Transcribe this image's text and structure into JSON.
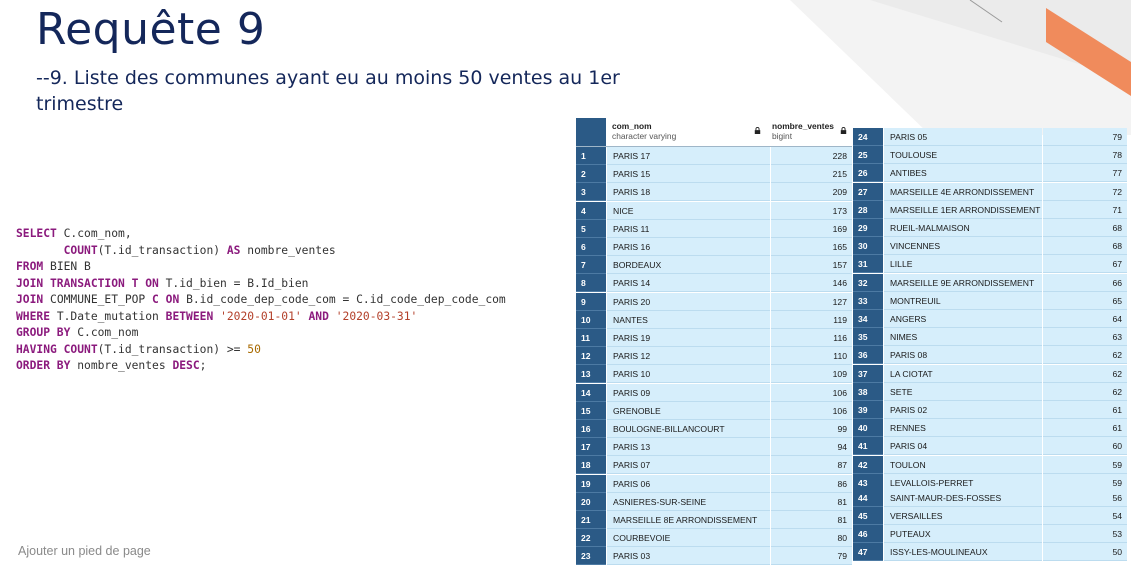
{
  "slide": {
    "title": "Requête 9",
    "subtitle": "--9. Liste des communes ayant eu au moins 50 ventes au 1er trimestre",
    "footer": "Ajouter un pied de page"
  },
  "sql": {
    "line1": [
      "SELECT",
      " C.com_nom,"
    ],
    "line2": [
      "COUNT",
      "(T.id_transaction) ",
      "AS",
      " nombre_ventes"
    ],
    "line3": [
      "FROM",
      " BIEN B"
    ],
    "line4": [
      "JOIN TRANSACTION T ON",
      " T.id_bien = B.Id_bien"
    ],
    "line5": [
      "JOIN",
      " COMMUNE_ET_POP ",
      "C ON",
      " B.id_code_dep_code_com = C.id_code_dep_code_com"
    ],
    "line6": [
      "WHERE",
      " T.Date_mutation ",
      "BETWEEN",
      "'2020-01-01'",
      "AND",
      "'2020-03-31'"
    ],
    "line7": [
      "GROUP BY",
      " C.com_nom"
    ],
    "line8": [
      "HAVING COUNT",
      "(T.id_transaction) >= ",
      "50"
    ],
    "line9": [
      "ORDER BY",
      " nombre_ventes ",
      "DESC",
      ";"
    ]
  },
  "result_table": {
    "columns": [
      {
        "name": "com_nom",
        "type": "character varying"
      },
      {
        "name": "nombre_ventes",
        "type": "bigint"
      }
    ],
    "rows": [
      {
        "i": "1",
        "com": "PARIS 17",
        "n": "228"
      },
      {
        "i": "2",
        "com": "PARIS 15",
        "n": "215"
      },
      {
        "i": "3",
        "com": "PARIS 18",
        "n": "209"
      },
      {
        "i": "4",
        "com": "NICE",
        "n": "173"
      },
      {
        "i": "5",
        "com": "PARIS 11",
        "n": "169"
      },
      {
        "i": "6",
        "com": "PARIS 16",
        "n": "165"
      },
      {
        "i": "7",
        "com": "BORDEAUX",
        "n": "157"
      },
      {
        "i": "8",
        "com": "PARIS 14",
        "n": "146"
      },
      {
        "i": "9",
        "com": "PARIS 20",
        "n": "127"
      },
      {
        "i": "10",
        "com": "NANTES",
        "n": "119"
      },
      {
        "i": "11",
        "com": "PARIS 19",
        "n": "116"
      },
      {
        "i": "12",
        "com": "PARIS 12",
        "n": "110"
      },
      {
        "i": "13",
        "com": "PARIS 10",
        "n": "109"
      },
      {
        "i": "14",
        "com": "PARIS 09",
        "n": "106"
      },
      {
        "i": "15",
        "com": "GRENOBLE",
        "n": "106"
      },
      {
        "i": "16",
        "com": "BOULOGNE-BILLANCOURT",
        "n": "99"
      },
      {
        "i": "17",
        "com": "PARIS 13",
        "n": "94"
      },
      {
        "i": "18",
        "com": "PARIS 07",
        "n": "87"
      },
      {
        "i": "19",
        "com": "PARIS 06",
        "n": "86"
      },
      {
        "i": "20",
        "com": "ASNIERES-SUR-SEINE",
        "n": "81"
      },
      {
        "i": "21",
        "com": "MARSEILLE 8E ARRONDISSEMENT",
        "n": "81"
      },
      {
        "i": "22",
        "com": "COURBEVOIE",
        "n": "80"
      },
      {
        "i": "23",
        "com": "PARIS 03",
        "n": "79"
      },
      {
        "i": "24",
        "com": "PARIS 05",
        "n": "79"
      },
      {
        "i": "25",
        "com": "TOULOUSE",
        "n": "78"
      },
      {
        "i": "26",
        "com": "ANTIBES",
        "n": "77"
      },
      {
        "i": "27",
        "com": "MARSEILLE 4E ARRONDISSEMENT",
        "n": "72"
      },
      {
        "i": "28",
        "com": "MARSEILLE 1ER ARRONDISSEMENT",
        "n": "71"
      },
      {
        "i": "29",
        "com": "RUEIL-MALMAISON",
        "n": "68"
      },
      {
        "i": "30",
        "com": "VINCENNES",
        "n": "68"
      },
      {
        "i": "31",
        "com": "LILLE",
        "n": "67"
      },
      {
        "i": "32",
        "com": "MARSEILLE 9E ARRONDISSEMENT",
        "n": "66"
      },
      {
        "i": "33",
        "com": "MONTREUIL",
        "n": "65"
      },
      {
        "i": "34",
        "com": "ANGERS",
        "n": "64"
      },
      {
        "i": "35",
        "com": "NIMES",
        "n": "63"
      },
      {
        "i": "36",
        "com": "PARIS 08",
        "n": "62"
      },
      {
        "i": "37",
        "com": "LA CIOTAT",
        "n": "62"
      },
      {
        "i": "38",
        "com": "SETE",
        "n": "62"
      },
      {
        "i": "39",
        "com": "PARIS 02",
        "n": "61"
      },
      {
        "i": "40",
        "com": "RENNES",
        "n": "61"
      },
      {
        "i": "41",
        "com": "PARIS 04",
        "n": "60"
      },
      {
        "i": "42",
        "com": "TOULON",
        "n": "59"
      },
      {
        "i": "43",
        "com": "LEVALLOIS-PERRET",
        "n": "59"
      },
      {
        "i": "44",
        "com": "SAINT-MAUR-DES-FOSSES",
        "n": "56"
      },
      {
        "i": "45",
        "com": "VERSAILLES",
        "n": "54"
      },
      {
        "i": "46",
        "com": "PUTEAUX",
        "n": "53"
      },
      {
        "i": "47",
        "com": "ISSY-LES-MOULINEAUX",
        "n": "50"
      }
    ]
  },
  "colors": {
    "title": "#14275a",
    "index_column": "#2b5a86",
    "cell_background": "#d6eefb",
    "deco_orange": "#f08b5c"
  },
  "icons": [
    "lock-icon"
  ]
}
